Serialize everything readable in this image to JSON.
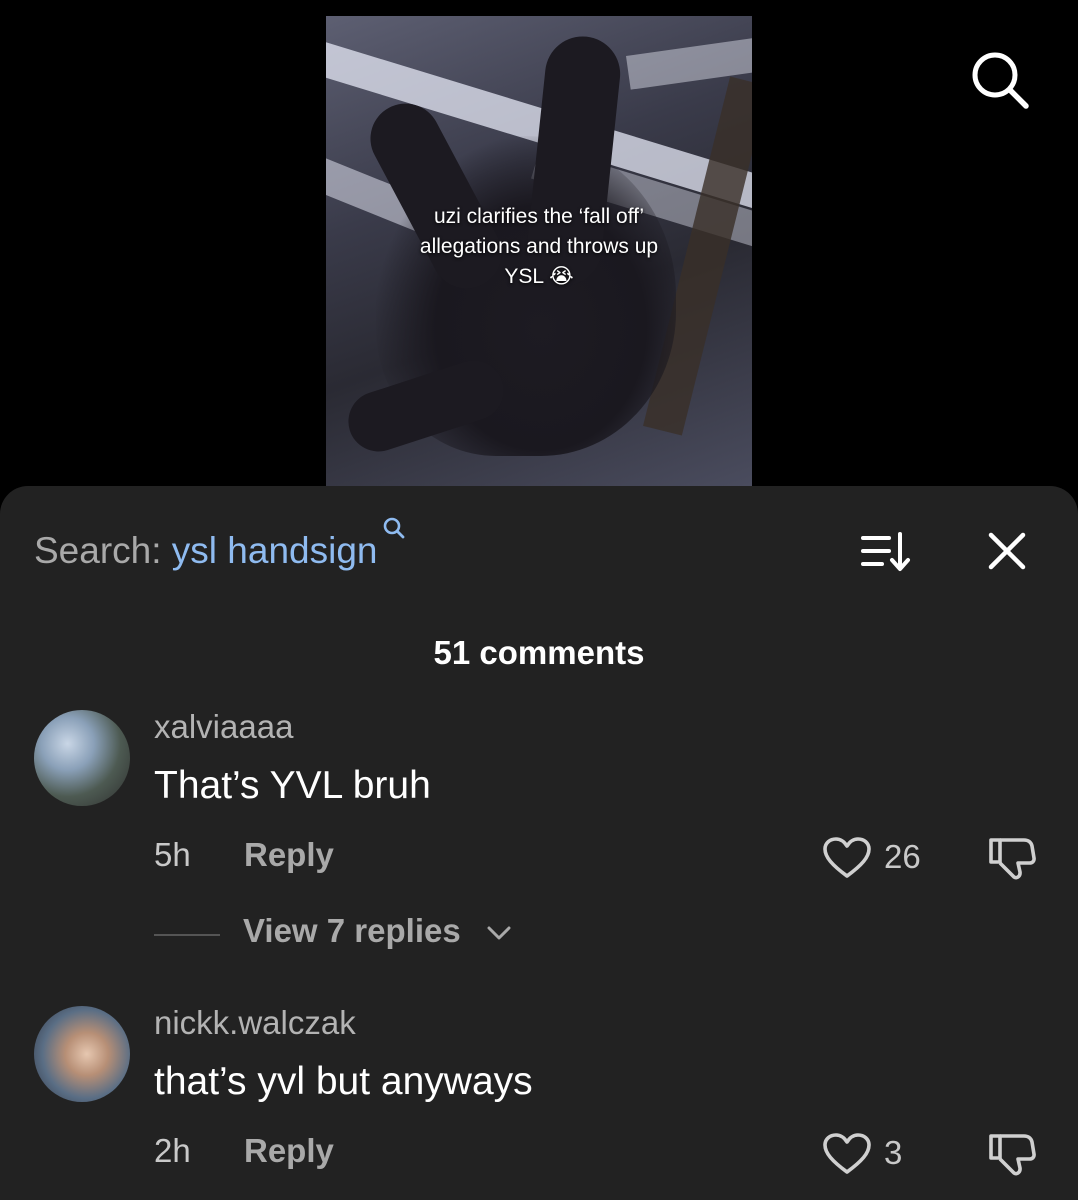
{
  "video": {
    "caption_line1": "uzi clarifies the ‘fall off’",
    "caption_line2": "allegations and throws up",
    "caption_line3": "YSL 😭"
  },
  "icons": {
    "top_search": "search-icon",
    "search_hint": "search-icon",
    "sort": "sort-icon",
    "close": "close-icon",
    "like": "heart-icon",
    "dislike": "thumbs-down-icon",
    "chevron": "chevron-down-icon"
  },
  "colors": {
    "background": "#000000",
    "sheet": "#222222",
    "search_term": "#8fbbf0",
    "muted": "#a9a9a9"
  },
  "comments_sheet": {
    "search_label": "Search: ",
    "search_term": "ysl handsign",
    "comment_count": "51 comments",
    "comments": [
      {
        "username": "xalviaaaa",
        "text": "That’s YVL bruh",
        "time": "5h",
        "reply_label": "Reply",
        "likes": "26"
      },
      {
        "username": "nickk.walczak",
        "text": "that’s yvl but anyways",
        "time": "2h",
        "reply_label": "Reply",
        "likes": "3"
      }
    ],
    "view_replies_label": "View 7 replies"
  }
}
